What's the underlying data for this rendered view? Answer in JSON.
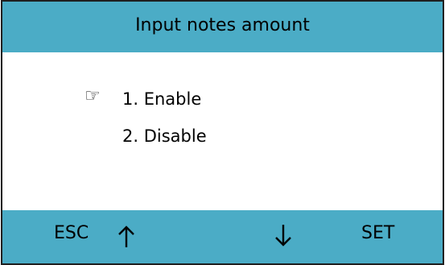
{
  "title": "Input notes amount",
  "menu": {
    "items": [
      {
        "label": "1. Enable"
      },
      {
        "label": "2. Disable"
      }
    ],
    "selected_index": 0,
    "pointer_icon": "pointing-hand-icon"
  },
  "footer": {
    "esc_label": "ESC",
    "up_icon": "arrow-up-icon",
    "down_icon": "arrow-down-icon",
    "set_label": "SET"
  },
  "colors": {
    "bar": "#4bacc6",
    "border": "#1f1f1f",
    "background": "#ffffff",
    "text": "#000000"
  }
}
